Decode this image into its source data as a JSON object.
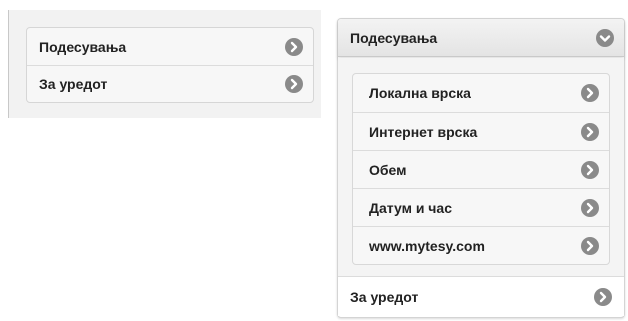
{
  "collapsed_menu": {
    "items": [
      {
        "label": "Подесувања",
        "icon": "chevron-right-icon"
      },
      {
        "label": "За уредот",
        "icon": "chevron-right-icon"
      }
    ]
  },
  "expanded_menu": {
    "header": {
      "label": "Подесувања",
      "icon": "chevron-down-icon"
    },
    "sub_items": [
      {
        "label": "Локална врска",
        "icon": "chevron-right-icon"
      },
      {
        "label": "Интернет врска",
        "icon": "chevron-right-icon"
      },
      {
        "label": "Обем",
        "icon": "chevron-right-icon"
      },
      {
        "label": "Датум и час",
        "icon": "chevron-right-icon"
      },
      {
        "label": "www.mytesy.com",
        "icon": "chevron-right-icon"
      }
    ],
    "footer_item": {
      "label": "За уредот",
      "icon": "chevron-right-icon"
    }
  },
  "colors": {
    "icon_fill": "#8a8a8a",
    "icon_glyph": "#ffffff"
  }
}
